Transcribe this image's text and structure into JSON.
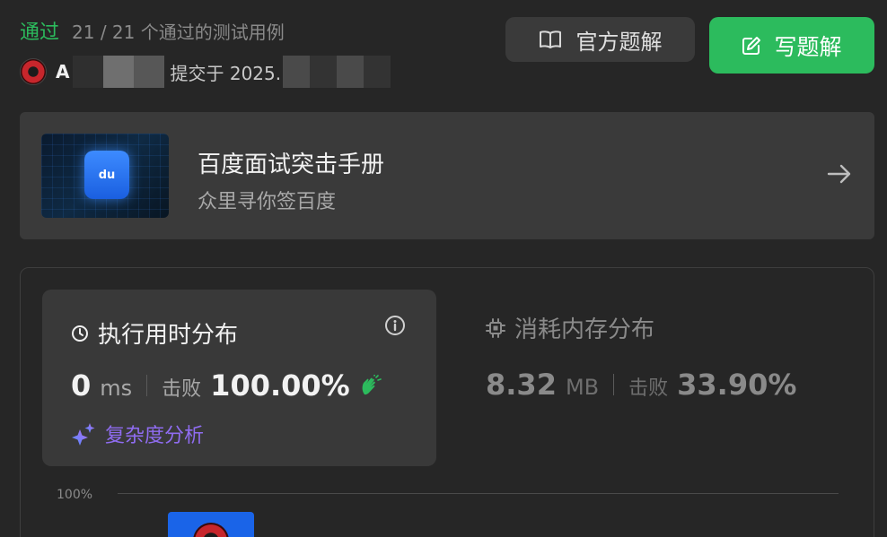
{
  "result": {
    "status": "通过",
    "cases": "21 / 21 个通过的测试用例"
  },
  "submission": {
    "user_initial": "A",
    "submitted_prefix": "提交于 2025."
  },
  "actions": {
    "official_solution": "官方题解",
    "write_solution": "写题解"
  },
  "banner": {
    "title": "百度面试突击手册",
    "subtitle": "众里寻你签百度",
    "logo_text": "du"
  },
  "runtime": {
    "title": "执行用时分布",
    "value": "0",
    "unit": "ms",
    "beats_label": "击败",
    "beats_pct": "100.00%",
    "complexity_label": "复杂度分析"
  },
  "memory": {
    "title": "消耗内存分布",
    "value": "8.32",
    "unit": "MB",
    "beats_label": "击败",
    "beats_pct": "33.90%"
  },
  "chart": {
    "y_label": "100%"
  },
  "colors": {
    "accent_green": "#2cbb5d",
    "complexity_purple": "#8f6cf0",
    "bar_blue": "#1a64e8"
  }
}
